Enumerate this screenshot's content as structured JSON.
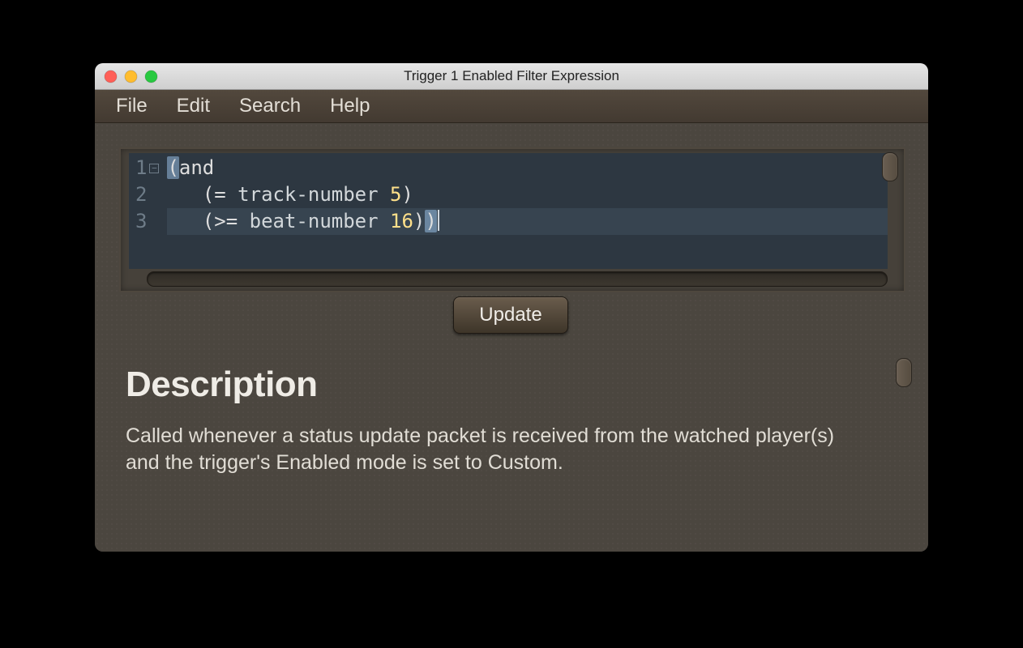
{
  "window": {
    "title": "Trigger 1 Enabled Filter Expression"
  },
  "menubar": {
    "items": [
      "File",
      "Edit",
      "Search",
      "Help"
    ]
  },
  "editor": {
    "lines": [
      {
        "number": "1",
        "foldable": true,
        "tokens": [
          {
            "type": "paren",
            "text": "(",
            "match": true
          },
          {
            "type": "kw",
            "text": "and"
          }
        ]
      },
      {
        "number": "2",
        "foldable": false,
        "tokens": [
          {
            "type": "space",
            "text": "   "
          },
          {
            "type": "paren",
            "text": "("
          },
          {
            "type": "kw",
            "text": "= "
          },
          {
            "type": "sym",
            "text": "track-number "
          },
          {
            "type": "num",
            "text": "5"
          },
          {
            "type": "paren",
            "text": ")"
          }
        ]
      },
      {
        "number": "3",
        "foldable": false,
        "active": true,
        "caretAfter": true,
        "tokens": [
          {
            "type": "space",
            "text": "   "
          },
          {
            "type": "paren",
            "text": "("
          },
          {
            "type": "kw",
            "text": ">= "
          },
          {
            "type": "sym",
            "text": "beat-number "
          },
          {
            "type": "num",
            "text": "16"
          },
          {
            "type": "paren",
            "text": ")"
          },
          {
            "type": "paren",
            "text": ")",
            "match": true
          }
        ]
      }
    ]
  },
  "buttons": {
    "update": "Update"
  },
  "description": {
    "heading": "Description",
    "body": "Called whenever a status update packet is received from the watched player(s) and the trigger's Enabled mode is set to Custom."
  }
}
